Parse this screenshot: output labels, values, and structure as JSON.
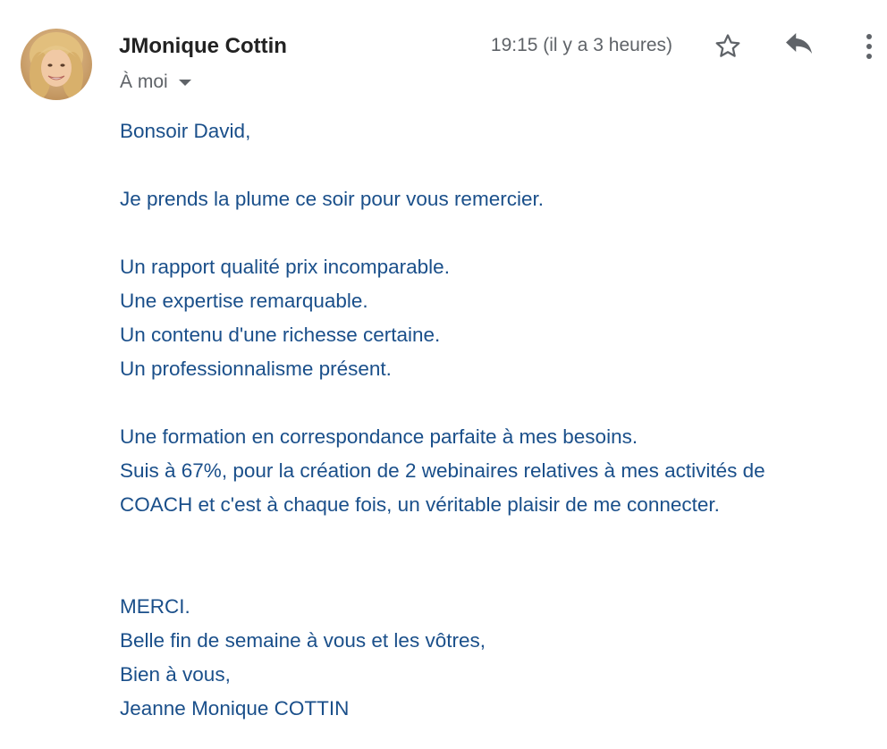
{
  "header": {
    "sender_name": "JMonique Cottin",
    "recipient": "À moi",
    "timestamp": "19:15 (il y a 3 heures)",
    "icons": {
      "avatar": "sender-avatar",
      "star": "star-outline-icon",
      "reply": "reply-icon",
      "more": "more-vertical-icon",
      "dropdown": "chevron-down-icon"
    }
  },
  "message": {
    "greeting": "Bonsoir David,",
    "intro": "Je prends la plume ce soir pour vous remercier.",
    "points": [
      "Un rapport qualité prix incomparable.",
      "Une expertise remarquable.",
      "Un contenu d'une richesse certaine.",
      "Un professionnalisme présent."
    ],
    "paragraph": [
      "Une formation en correspondance parfaite à mes besoins.",
      "Suis à 67%, pour la création de 2 webinaires relatives à mes activités de",
      "COACH et c'est à chaque fois, un véritable plaisir de me connecter."
    ],
    "closing": [
      "MERCI.",
      "Belle fin de semaine à vous et les vôtres,",
      "Bien à vous,",
      "Jeanne Monique COTTIN"
    ]
  },
  "colors": {
    "body_text": "#1a4f8a",
    "sender_text": "#222222",
    "meta_text": "#5f6368"
  }
}
